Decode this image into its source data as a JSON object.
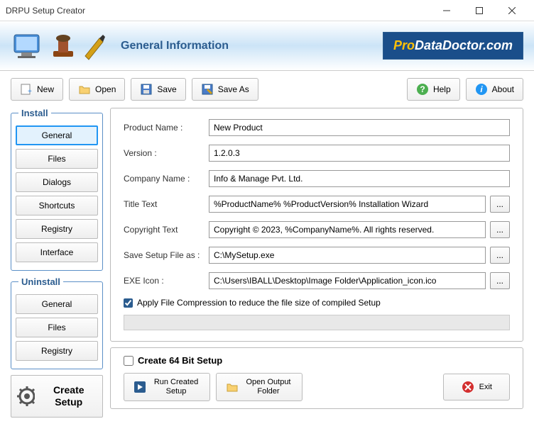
{
  "window": {
    "title": "DRPU Setup Creator"
  },
  "banner": {
    "title": "General Information",
    "logo_pro": "Pro",
    "logo_rest": "DataDoctor.com"
  },
  "toolbar": {
    "new": "New",
    "open": "Open",
    "save": "Save",
    "saveas": "Save As",
    "help": "Help",
    "about": "About"
  },
  "sidebar": {
    "install_legend": "Install",
    "install_items": [
      "General",
      "Files",
      "Dialogs",
      "Shortcuts",
      "Registry",
      "Interface"
    ],
    "uninstall_legend": "Uninstall",
    "uninstall_items": [
      "General",
      "Files",
      "Registry"
    ],
    "create_setup": "Create Setup"
  },
  "form": {
    "product_name_label": "Product Name :",
    "product_name": "New Product",
    "version_label": "Version :",
    "version": "1.2.0.3",
    "company_label": "Company Name :",
    "company": "Info & Manage Pvt. Ltd.",
    "titletext_label": "Title Text",
    "titletext": "%ProductName% %ProductVersion% Installation Wizard",
    "copyright_label": "Copyright Text",
    "copyright": "Copyright © 2023, %CompanyName%. All rights reserved.",
    "savesetup_label": "Save Setup File as :",
    "savesetup": "C:\\MySetup.exe",
    "exeicon_label": "EXE Icon :",
    "exeicon": "C:\\Users\\IBALL\\Desktop\\Image Folder\\Application_icon.ico",
    "browse": "...",
    "compression_label": "Apply File Compression to reduce the file size of compiled Setup"
  },
  "bottom": {
    "create64": "Create 64 Bit Setup",
    "run_created": "Run Created Setup",
    "open_output": "Open Output Folder",
    "exit": "Exit"
  }
}
